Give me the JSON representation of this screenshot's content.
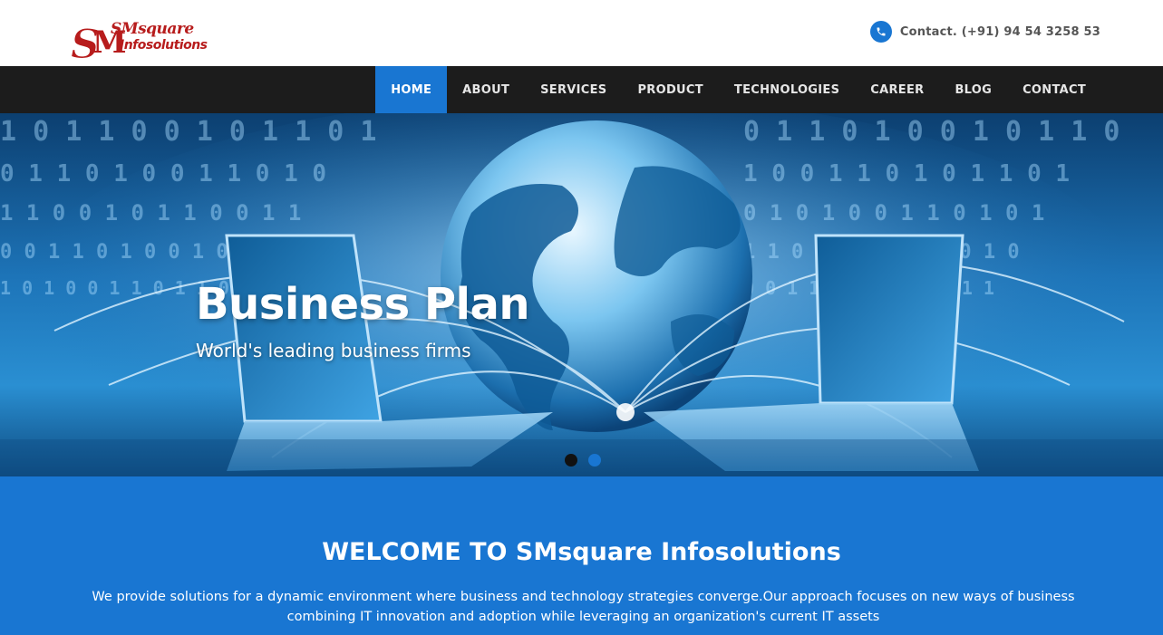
{
  "brand": {
    "logo_line1": "SMsquare",
    "logo_line2": "Infosolutions",
    "logo_color": "#b71c1c"
  },
  "header": {
    "contact_text": "Contact. (+91) 94 54 3258 53",
    "icon": "phone-icon",
    "accent": "#1976d2"
  },
  "nav": {
    "items": [
      {
        "label": "HOME",
        "active": true
      },
      {
        "label": "ABOUT"
      },
      {
        "label": "SERVICES"
      },
      {
        "label": "PRODUCT"
      },
      {
        "label": "TECHNOLOGIES"
      },
      {
        "label": "CAREER"
      },
      {
        "label": "BLOG"
      },
      {
        "label": "CONTACT"
      }
    ],
    "background": "#1c1c1c"
  },
  "hero": {
    "title": "Business Plan",
    "subtitle": "World's leading business firms",
    "slides": 2,
    "active_slide": 1
  },
  "welcome": {
    "title": "WELCOME TO SMsquare Infosolutions",
    "text": "We provide solutions for a dynamic environment where business and technology strategies converge.Our approach focuses on new ways of business combining IT innovation and adoption while leveraging an organization's current IT assets",
    "background": "#1976d2"
  }
}
